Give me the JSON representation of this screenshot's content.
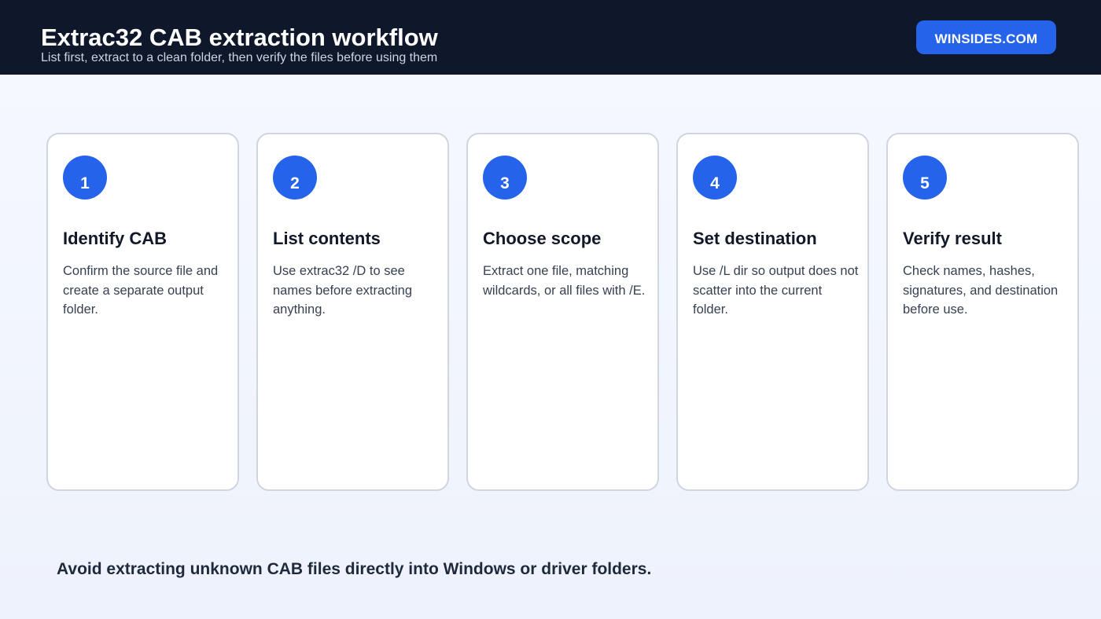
{
  "header": {
    "title": "Extrac32 CAB extraction workflow",
    "subtitle": "List first, extract to a clean folder, then verify the files before using them",
    "brand": "WINSIDES.COM"
  },
  "steps": [
    {
      "number": "1",
      "title": "Identify CAB",
      "description": "Confirm the source file and create a separate output folder."
    },
    {
      "number": "2",
      "title": "List contents",
      "description": "Use extrac32 /D to see names before extracting anything."
    },
    {
      "number": "3",
      "title": "Choose scope",
      "description": "Extract one file, matching wildcards, or all files with /E."
    },
    {
      "number": "4",
      "title": "Set destination",
      "description": "Use /L dir so output does not scatter into the current folder."
    },
    {
      "number": "5",
      "title": "Verify result",
      "description": "Check names, hashes, signatures, and destination before use."
    }
  ],
  "footer": {
    "note": "Avoid extracting unknown CAB files directly into Windows or driver folders."
  },
  "colors": {
    "header_bg": "#0f172a",
    "accent": "#2563eb",
    "card_border": "#cfd6e1",
    "page_bg": "#f3f6fd"
  }
}
